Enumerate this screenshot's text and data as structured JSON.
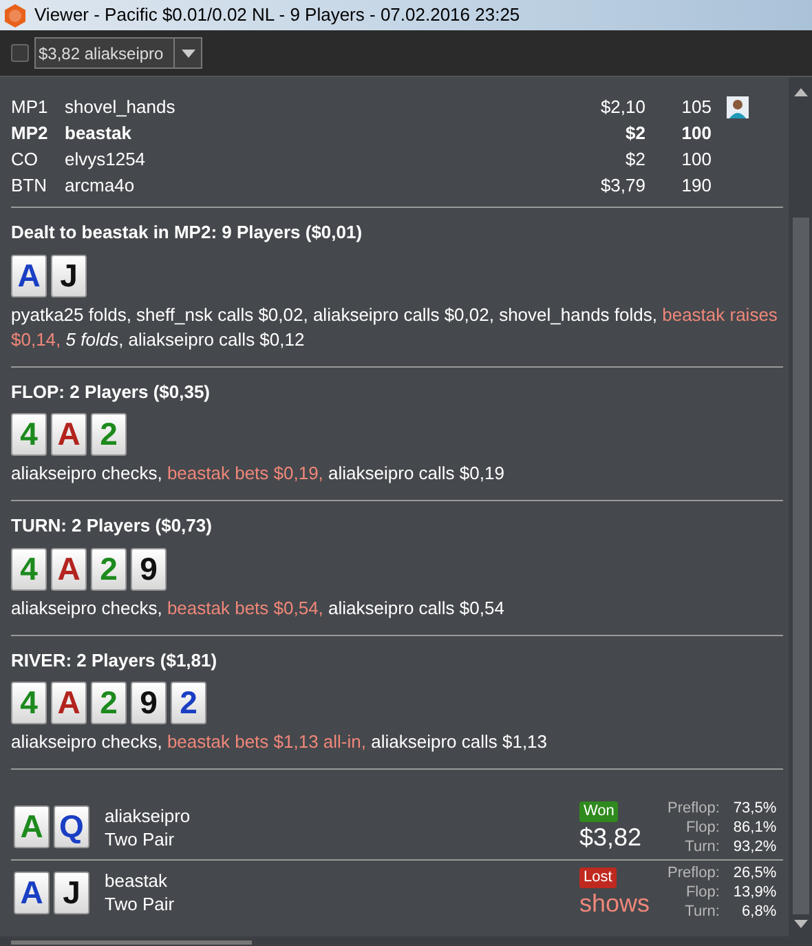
{
  "window": {
    "title": "Viewer - Pacific $0.01/0.02 NL - 9 Players - 07.02.2016 23:25"
  },
  "toolbar": {
    "checkbox": {
      "checked": false
    },
    "player_select": {
      "value": "$3,82 aliakseipro"
    }
  },
  "seats": [
    {
      "position": "MP1",
      "name": "shovel_hands",
      "stack": "$2,10",
      "bb": "105",
      "hero": false,
      "avatar": true
    },
    {
      "position": "MP2",
      "name": "beastak",
      "stack": "$2",
      "bb": "100",
      "hero": true,
      "avatar": false
    },
    {
      "position": "CO",
      "name": "elvys1254",
      "stack": "$2",
      "bb": "100",
      "hero": false,
      "avatar": false
    },
    {
      "position": "BTN",
      "name": "arcma4o",
      "stack": "$3,79",
      "bb": "190",
      "hero": false,
      "avatar": false
    }
  ],
  "streets": [
    {
      "title": "Dealt to beastak in MP2: 9 Players ($0,01)",
      "cards": [
        {
          "rank": "A",
          "color": "#1a3fc4"
        },
        {
          "rank": "J",
          "color": "#111111"
        }
      ],
      "actions": [
        {
          "text": "pyatka25 folds, sheff_nsk calls $0,02, aliakseipro calls $0,02, shovel_hands folds, ",
          "kind": "plain"
        },
        {
          "text": "beastak raises $0,14, ",
          "kind": "hero"
        },
        {
          "text": "5 folds",
          "kind": "italic"
        },
        {
          "text": ", aliakseipro calls $0,12",
          "kind": "plain"
        }
      ]
    },
    {
      "title": "FLOP: 2 Players ($0,35)",
      "cards": [
        {
          "rank": "4",
          "color": "#1d8a1d"
        },
        {
          "rank": "A",
          "color": "#b3241f"
        },
        {
          "rank": "2",
          "color": "#1d8a1d"
        }
      ],
      "actions": [
        {
          "text": "aliakseipro checks, ",
          "kind": "plain"
        },
        {
          "text": "beastak bets $0,19,",
          "kind": "hero"
        },
        {
          "text": " aliakseipro calls $0,19",
          "kind": "plain"
        }
      ]
    },
    {
      "title": "TURN: 2 Players ($0,73)",
      "cards": [
        {
          "rank": "4",
          "color": "#1d8a1d"
        },
        {
          "rank": "A",
          "color": "#b3241f"
        },
        {
          "rank": "2",
          "color": "#1d8a1d"
        },
        {
          "rank": "9",
          "color": "#111111"
        }
      ],
      "actions": [
        {
          "text": "aliakseipro checks, ",
          "kind": "plain"
        },
        {
          "text": "beastak bets $0,54,",
          "kind": "hero"
        },
        {
          "text": " aliakseipro calls $0,54",
          "kind": "plain"
        }
      ]
    },
    {
      "title": "RIVER: 2 Players ($1,81)",
      "cards": [
        {
          "rank": "4",
          "color": "#1d8a1d"
        },
        {
          "rank": "A",
          "color": "#b3241f"
        },
        {
          "rank": "2",
          "color": "#1d8a1d"
        },
        {
          "rank": "9",
          "color": "#111111"
        },
        {
          "rank": "2",
          "color": "#1a3fc4"
        }
      ],
      "actions": [
        {
          "text": "aliakseipro checks, ",
          "kind": "plain"
        },
        {
          "text": "beastak bets $1,13 all-in,",
          "kind": "hero"
        },
        {
          "text": " aliakseipro calls $1,13",
          "kind": "plain"
        }
      ]
    }
  ],
  "showdown": [
    {
      "cards": [
        {
          "rank": "A",
          "color": "#1d8a1d"
        },
        {
          "rank": "Q",
          "color": "#1a3fc4"
        }
      ],
      "name": "aliakseipro",
      "hand": "Two Pair",
      "won": true,
      "badge": "Won",
      "amount": "$3,82",
      "equity": [
        {
          "label": "Preflop:",
          "value": "73,5%"
        },
        {
          "label": "Flop:",
          "value": "86,1%"
        },
        {
          "label": "Turn:",
          "value": "93,2%"
        }
      ]
    },
    {
      "cards": [
        {
          "rank": "A",
          "color": "#1a3fc4"
        },
        {
          "rank": "J",
          "color": "#111111"
        }
      ],
      "name": "beastak",
      "hand": "Two Pair",
      "won": false,
      "badge": "Lost",
      "amount": "shows",
      "equity": [
        {
          "label": "Preflop:",
          "value": "26,5%"
        },
        {
          "label": "Flop:",
          "value": "13,9%"
        },
        {
          "label": "Turn:",
          "value": "6,8%"
        }
      ]
    }
  ]
}
